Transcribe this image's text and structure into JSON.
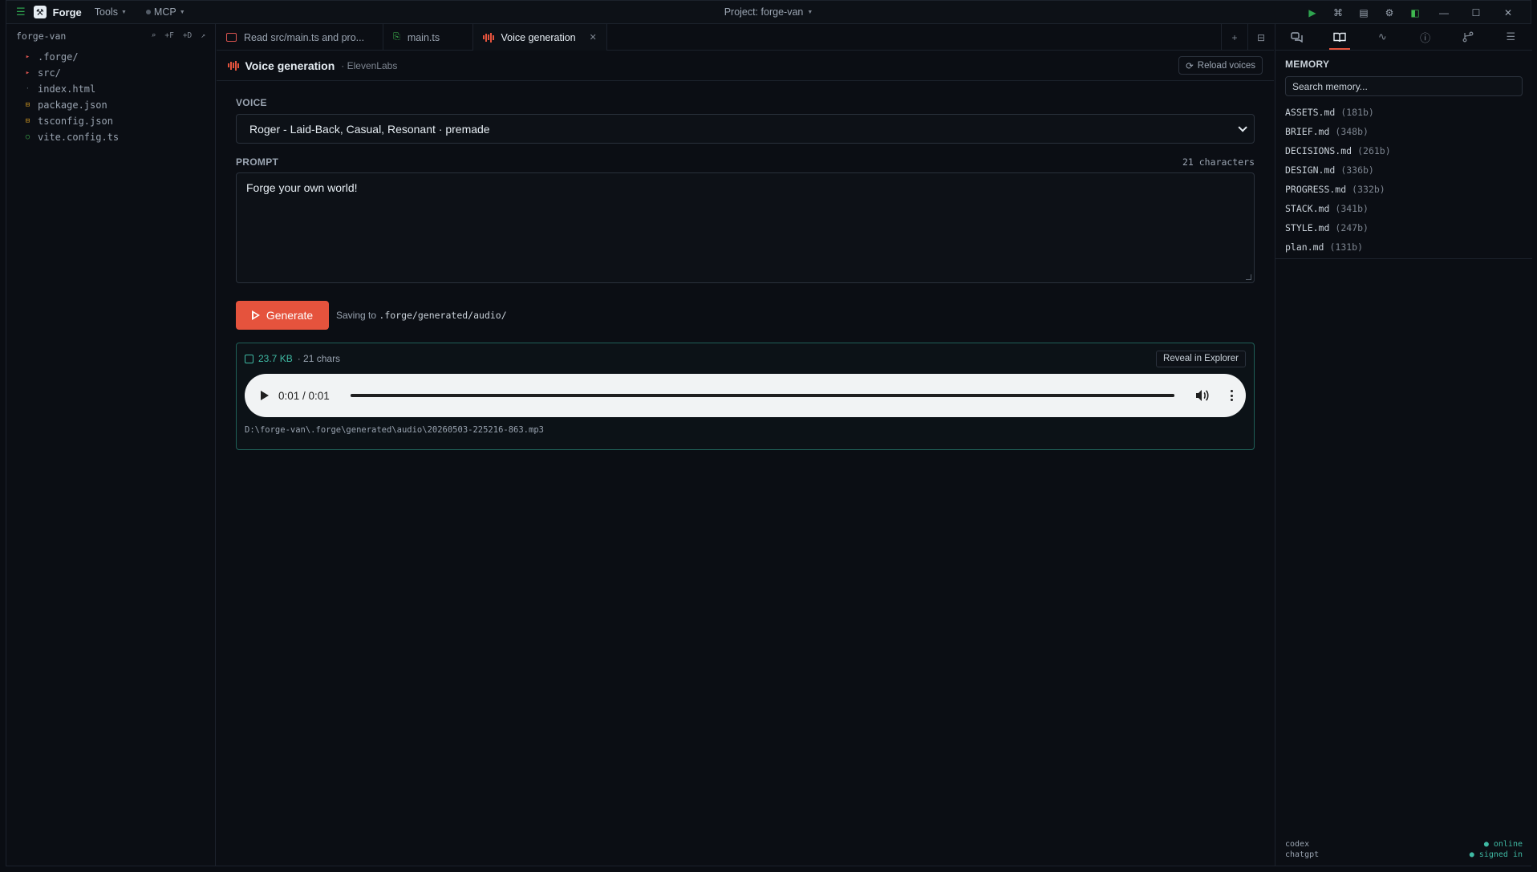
{
  "app": {
    "name": "Forge",
    "menu_tools": "Tools",
    "menu_mcp": "MCP",
    "project": "Project: forge-van"
  },
  "sidebar": {
    "title": "forge-van",
    "actions": [
      "⌕",
      "+F",
      "+D",
      "↗"
    ],
    "items": [
      {
        "name": ".forge/",
        "kind": "folder"
      },
      {
        "name": "src/",
        "kind": "folder"
      },
      {
        "name": "index.html",
        "kind": "html"
      },
      {
        "name": "package.json",
        "kind": "json"
      },
      {
        "name": "tsconfig.json",
        "kind": "json"
      },
      {
        "name": "vite.config.ts",
        "kind": "ts"
      }
    ]
  },
  "tabs": {
    "chat": "Read src/main.ts and pro...",
    "code": "main.ts",
    "voice": "Voice generation"
  },
  "panel": {
    "title": "Voice generation",
    "subtitle": "· ElevenLabs",
    "reload": "Reload voices"
  },
  "voice": {
    "label": "VOICE",
    "selected": "Roger - Laid-Back, Casual, Resonant · premade"
  },
  "prompt": {
    "label": "PROMPT",
    "count": "21 characters",
    "text": "Forge your own world!"
  },
  "generate": {
    "label": "Generate",
    "saving_prefix": "Saving to",
    "saving_path": ".forge/generated/audio/"
  },
  "result": {
    "size": "23.7 KB",
    "chars": "· 21 chars",
    "reveal": "Reveal in Explorer",
    "time": "0:01 / 0:01",
    "progress": 1.0,
    "path": "D:\\forge-van\\.forge\\generated\\audio\\20260503-225216-863.mp3"
  },
  "memory": {
    "title": "MEMORY",
    "placeholder": "Search memory...",
    "files": [
      {
        "name": "ASSETS.md",
        "size": "(181b)"
      },
      {
        "name": "BRIEF.md",
        "size": "(348b)"
      },
      {
        "name": "DECISIONS.md",
        "size": "(261b)"
      },
      {
        "name": "DESIGN.md",
        "size": "(336b)"
      },
      {
        "name": "PROGRESS.md",
        "size": "(332b)"
      },
      {
        "name": "STACK.md",
        "size": "(341b)"
      },
      {
        "name": "STYLE.md",
        "size": "(247b)"
      },
      {
        "name": "plan.md",
        "size": "(131b)"
      }
    ]
  },
  "footer": {
    "rows": [
      {
        "name": "codex",
        "status": "● online"
      },
      {
        "name": "chatgpt",
        "status": "● signed in"
      }
    ]
  },
  "colors": {
    "accent": "#e5533d",
    "teal": "#3fb9a3",
    "bg": "#0b0e14"
  },
  "icons": {
    "menu": "hamburger-icon",
    "run": "play-icon",
    "close_tab": "close-icon",
    "reload": "refresh-icon",
    "save": "save-icon"
  }
}
